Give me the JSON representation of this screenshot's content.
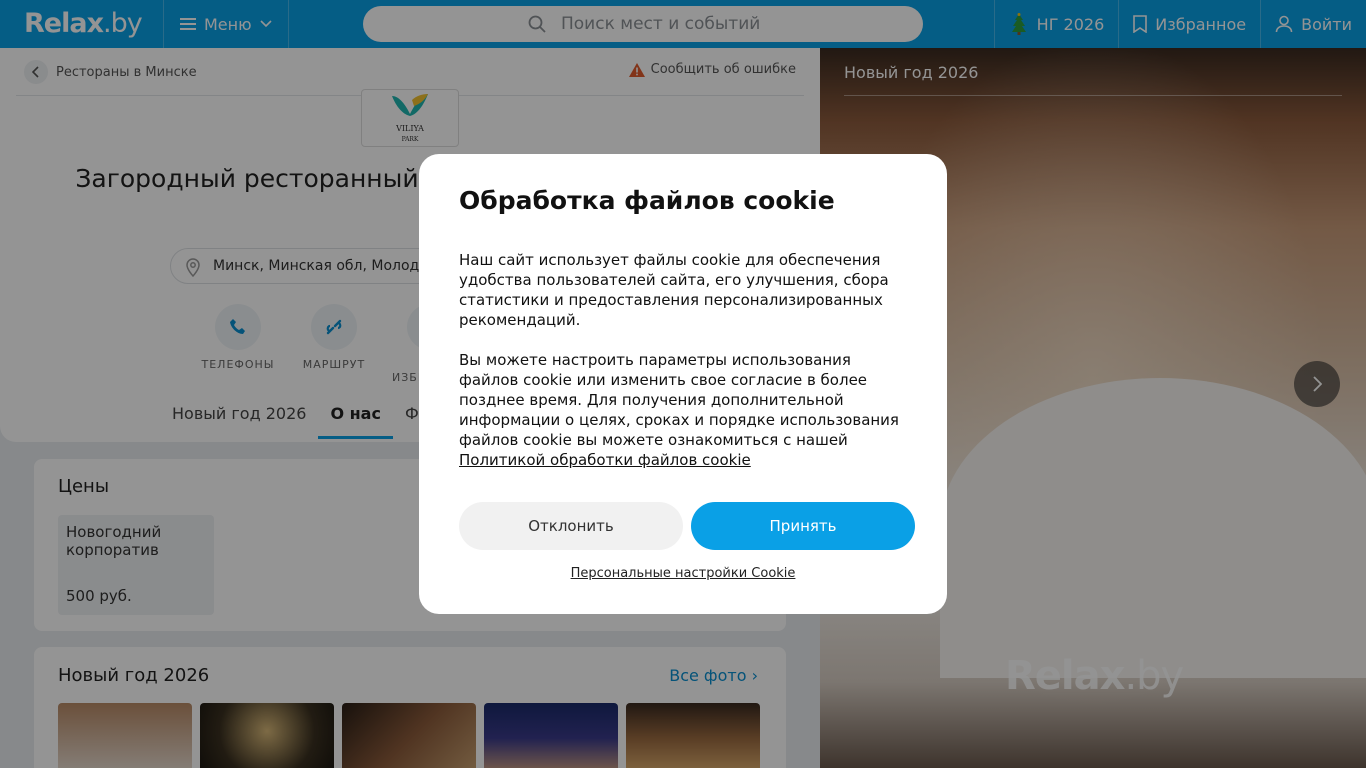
{
  "header": {
    "logo_main": "Relax",
    "logo_dot": ".by",
    "menu_label": "Меню",
    "search_placeholder": "Поиск мест и событий",
    "ny_label": "НГ 2026",
    "favorites_label": "Избранное",
    "login_label": "Войти",
    "accent_color": "#0aa0e6"
  },
  "page": {
    "breadcrumb": "Рестораны в Минске",
    "report_label": "Сообщить об ошибке",
    "venue_logo_text": "VILIYA",
    "venue_logo_sub": "PARK",
    "title": "Загородный ресторанный комплекс «Вилия Парк»",
    "address": "Минск, Минская обл, Молодечненский р-н",
    "actions": [
      "ТЕЛЕФОНЫ",
      "МАРШРУТ",
      "В ИЗБРАННОЕ"
    ],
    "tabs": [
      "Новый год 2026",
      "О нас",
      "Фото"
    ],
    "active_tab": "О нас"
  },
  "prices": {
    "heading": "Цены",
    "item_label": "Новогодний корпоратив",
    "item_value": "500 руб."
  },
  "newyear": {
    "heading": "Новый год 2026",
    "all_photos": "Все фото"
  },
  "gallery": {
    "caption": "Новый год 2026",
    "watermark_main": "Relax",
    "watermark_dot": ".by"
  },
  "cookie_modal": {
    "title": "Обработка файлов cookie",
    "paragraph1": "Наш сайт использует файлы cookie для обеспечения удобства пользователей сайта, его улучшения, сбора статистики и предоставления персонализированных рекомендаций.",
    "paragraph2": "Вы можете настроить параметры использования файлов cookie или изменить свое согласие в более позднее время. Для получения дополнительной информации о целях, сроках и порядке использования файлов cookie вы можете ознакомиться с нашей",
    "policy_link": "Политикой обработки файлов cookie",
    "decline_label": "Отклонить",
    "accept_label": "Принять",
    "settings_link": "Персональные настройки Cookie"
  }
}
